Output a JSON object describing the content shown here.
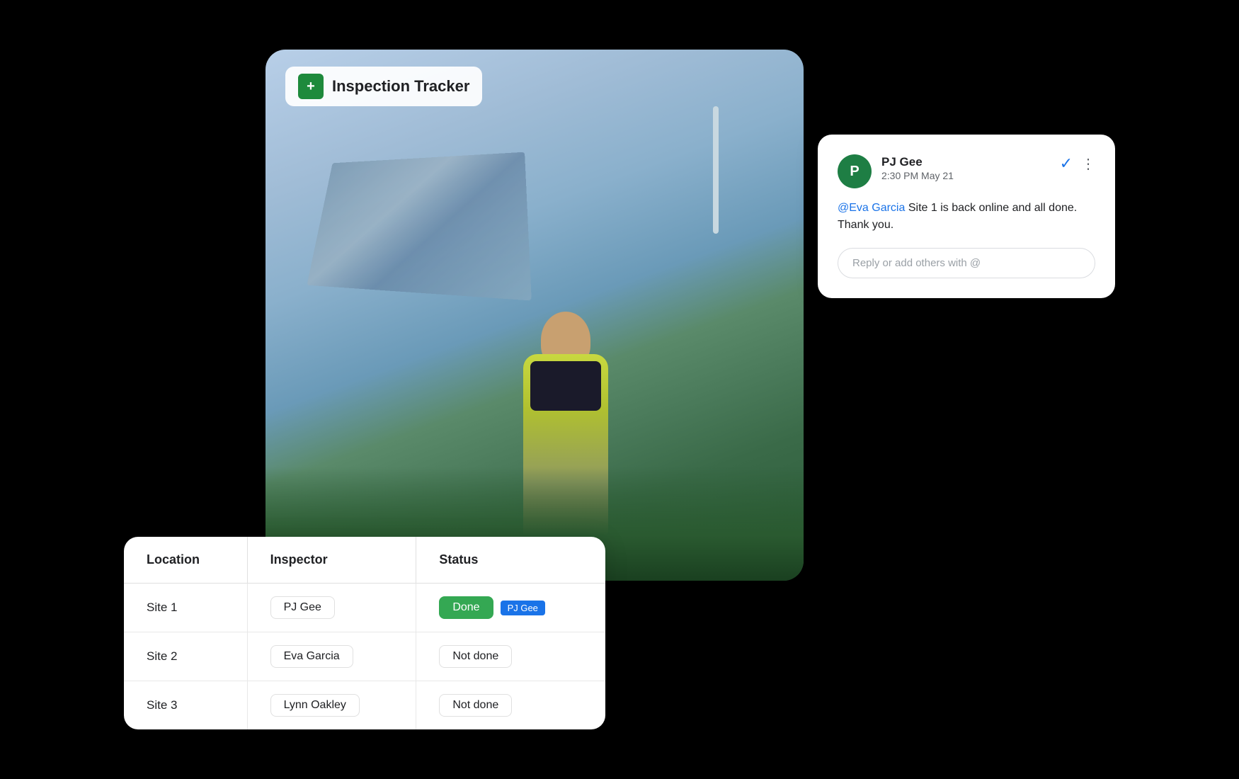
{
  "tracker": {
    "icon_label": "+",
    "title": "Inspection Tracker"
  },
  "comment": {
    "avatar_letter": "P",
    "commenter_name": "PJ Gee",
    "timestamp": "2:30 PM May 21",
    "mention": "@Eva Garcia",
    "message_text": " Site 1 is back online and all done. Thank you.",
    "reply_placeholder": "Reply or add others with @"
  },
  "table": {
    "headers": [
      "Location",
      "Inspector",
      "Status"
    ],
    "rows": [
      {
        "location": "Site 1",
        "inspector": "PJ Gee",
        "status": "Done",
        "status_type": "done",
        "badge": "PJ Gee"
      },
      {
        "location": "Site 2",
        "inspector": "Eva Garcia",
        "status": "Not done",
        "status_type": "not-done",
        "badge": ""
      },
      {
        "location": "Site 3",
        "inspector": "Lynn Oakley",
        "status": "Not done",
        "status_type": "not-done",
        "badge": ""
      }
    ]
  }
}
